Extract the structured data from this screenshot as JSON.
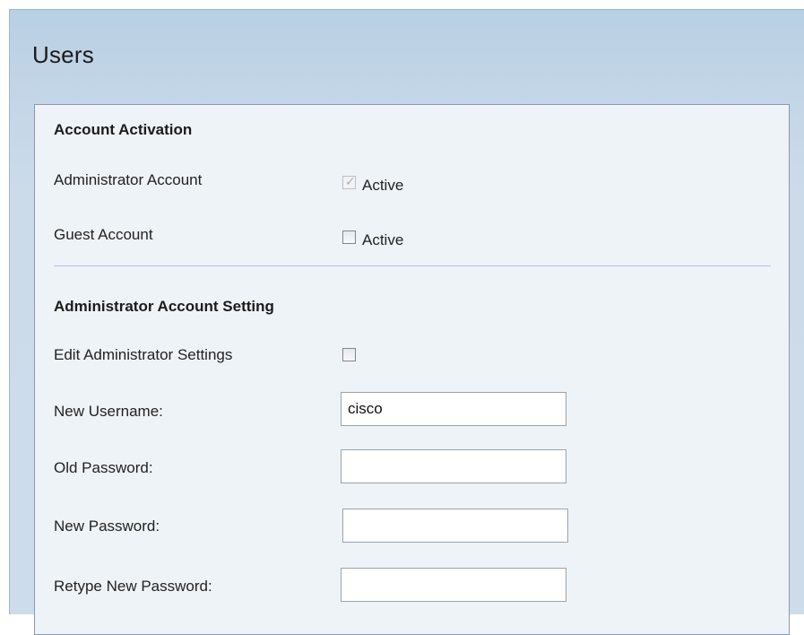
{
  "page": {
    "title": "Users"
  },
  "account_activation": {
    "title": "Account Activation",
    "admin_account": {
      "label": "Administrator Account",
      "checkbox_label": "Active",
      "checked": true,
      "disabled": true
    },
    "guest_account": {
      "label": "Guest Account",
      "checkbox_label": "Active",
      "checked": false
    }
  },
  "admin_setting": {
    "title": "Administrator Account Setting",
    "edit_settings": {
      "label": "Edit Administrator Settings",
      "checked": false
    },
    "new_username": {
      "label": "New Username:",
      "value": "cisco"
    },
    "old_password": {
      "label": "Old Password:",
      "value": ""
    },
    "new_password": {
      "label": "New Password:",
      "value": ""
    },
    "retype_password": {
      "label": "Retype New Password:",
      "value": ""
    }
  },
  "icons": {
    "check": "check-icon"
  },
  "colors": {
    "header_band": "#c3d6e7",
    "panel_background": "#eef3f7",
    "panel_border": "#8a9aab",
    "divider": "#b8c4e6"
  }
}
